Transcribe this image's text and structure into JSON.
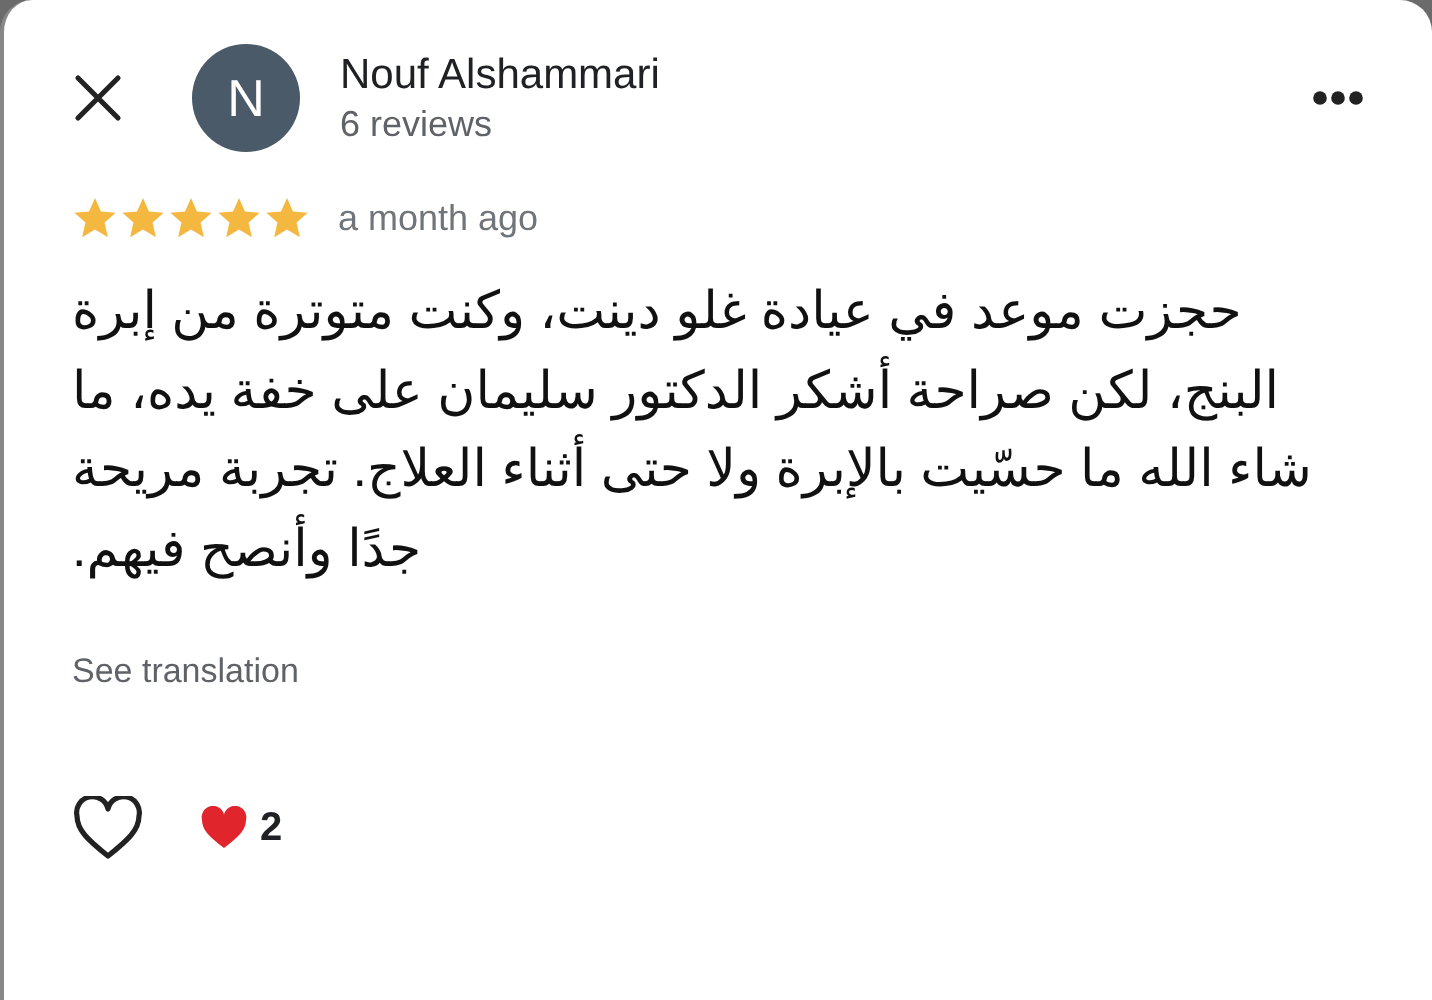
{
  "reviewer": {
    "initial": "N",
    "name": "Nouf Alshammari",
    "review_count": "6 reviews"
  },
  "review": {
    "stars": 5,
    "time": "a month ago",
    "text": "حجزت موعد في عيادة غلو دينت، وكنت متوترة من إبرة البنج، لكن صراحة أشكر الدكتور سليمان على خفة يده، ما شاء الله ما حسّيت بالإبرة ولا حتى أثناء العلاج. تجربة مريحة جدًا وأنصح فيهم.",
    "translate_link": "See translation"
  },
  "reactions": {
    "count": "2"
  }
}
